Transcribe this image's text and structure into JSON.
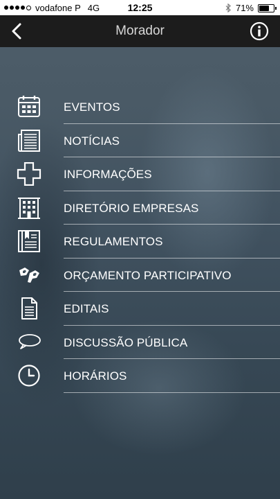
{
  "status_bar": {
    "carrier": "vodafone P",
    "network": "4G",
    "time": "12:25",
    "battery_percent": "71%",
    "battery_level": 0.71,
    "signal_bars": 4
  },
  "navbar": {
    "title": "Morador"
  },
  "menu": {
    "items": [
      {
        "label": "EVENTOS",
        "icon": "calendar-icon"
      },
      {
        "label": "NOTÍCIAS",
        "icon": "newspaper-icon"
      },
      {
        "label": "INFORMAÇÕES",
        "icon": "plus-cross-icon"
      },
      {
        "label": "DIRETÓRIO EMPRESAS",
        "icon": "building-icon"
      },
      {
        "label": "REGULAMENTOS",
        "icon": "regulation-book-icon"
      },
      {
        "label": "ORÇAMENTO PARTICIPATIVO",
        "icon": "op-logo-icon"
      },
      {
        "label": "EDITAIS",
        "icon": "document-icon"
      },
      {
        "label": "DISCUSSÃO PÚBLICA",
        "icon": "speech-bubble-icon"
      },
      {
        "label": "HORÁRIOS",
        "icon": "clock-icon"
      }
    ]
  },
  "colors": {
    "navbar_bg": "#1c1c1c",
    "text": "#ffffff",
    "divider": "#c8cfd4"
  }
}
